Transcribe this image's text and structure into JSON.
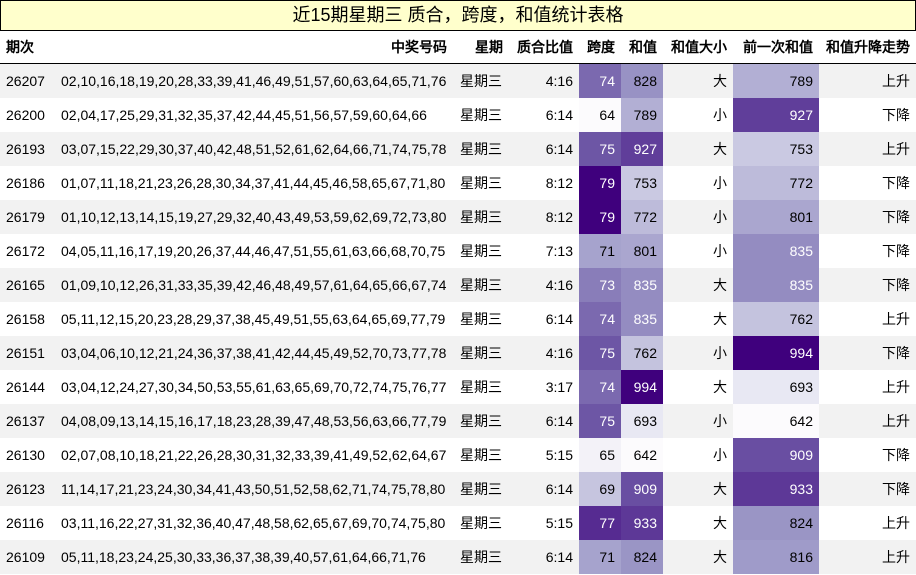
{
  "title": "近15期星期三 质合，跨度，和值统计表格",
  "headers": {
    "period": "期次",
    "numbers": "中奖号码",
    "weekday": "星期",
    "ratio": "质合比值",
    "span": "跨度",
    "sum": "和值",
    "size": "和值大小",
    "prev_sum": "前一次和值",
    "trend": "和值升降走势"
  },
  "heat_colors": {
    "low": "#fcfbfd",
    "high": "#3f007d"
  },
  "rows": [
    {
      "period": "26207",
      "numbers": "02,10,16,18,19,20,28,33,39,41,46,49,51,57,60,63,64,65,71,76",
      "weekday": "星期三",
      "ratio": "4:16",
      "span": "74",
      "sum": "828",
      "size": "大",
      "prev_sum": "789",
      "trend": "上升"
    },
    {
      "period": "26200",
      "numbers": "02,04,17,25,29,31,32,35,37,42,44,45,51,56,57,59,60,64,66",
      "weekday": "星期三",
      "ratio": "6:14",
      "span": "64",
      "sum": "789",
      "size": "小",
      "prev_sum": "927",
      "trend": "下降"
    },
    {
      "period": "26193",
      "numbers": "03,07,15,22,29,30,37,40,42,48,51,52,61,62,64,66,71,74,75,78",
      "weekday": "星期三",
      "ratio": "6:14",
      "span": "75",
      "sum": "927",
      "size": "大",
      "prev_sum": "753",
      "trend": "上升"
    },
    {
      "period": "26186",
      "numbers": "01,07,11,18,21,23,26,28,30,34,37,41,44,45,46,58,65,67,71,80",
      "weekday": "星期三",
      "ratio": "8:12",
      "span": "79",
      "sum": "753",
      "size": "小",
      "prev_sum": "772",
      "trend": "下降"
    },
    {
      "period": "26179",
      "numbers": "01,10,12,13,14,15,19,27,29,32,40,43,49,53,59,62,69,72,73,80",
      "weekday": "星期三",
      "ratio": "8:12",
      "span": "79",
      "sum": "772",
      "size": "小",
      "prev_sum": "801",
      "trend": "下降"
    },
    {
      "period": "26172",
      "numbers": "04,05,11,16,17,19,20,26,37,44,46,47,51,55,61,63,66,68,70,75",
      "weekday": "星期三",
      "ratio": "7:13",
      "span": "71",
      "sum": "801",
      "size": "小",
      "prev_sum": "835",
      "trend": "下降"
    },
    {
      "period": "26165",
      "numbers": "01,09,10,12,26,31,33,35,39,42,46,48,49,57,61,64,65,66,67,74",
      "weekday": "星期三",
      "ratio": "4:16",
      "span": "73",
      "sum": "835",
      "size": "大",
      "prev_sum": "835",
      "trend": "下降"
    },
    {
      "period": "26158",
      "numbers": "05,11,12,15,20,23,28,29,37,38,45,49,51,55,63,64,65,69,77,79",
      "weekday": "星期三",
      "ratio": "6:14",
      "span": "74",
      "sum": "835",
      "size": "大",
      "prev_sum": "762",
      "trend": "上升"
    },
    {
      "period": "26151",
      "numbers": "03,04,06,10,12,21,24,36,37,38,41,42,44,45,49,52,70,73,77,78",
      "weekday": "星期三",
      "ratio": "4:16",
      "span": "75",
      "sum": "762",
      "size": "小",
      "prev_sum": "994",
      "trend": "下降"
    },
    {
      "period": "26144",
      "numbers": "03,04,12,24,27,30,34,50,53,55,61,63,65,69,70,72,74,75,76,77",
      "weekday": "星期三",
      "ratio": "3:17",
      "span": "74",
      "sum": "994",
      "size": "大",
      "prev_sum": "693",
      "trend": "上升"
    },
    {
      "period": "26137",
      "numbers": "04,08,09,13,14,15,16,17,18,23,28,39,47,48,53,56,63,66,77,79",
      "weekday": "星期三",
      "ratio": "6:14",
      "span": "75",
      "sum": "693",
      "size": "小",
      "prev_sum": "642",
      "trend": "上升"
    },
    {
      "period": "26130",
      "numbers": "02,07,08,10,18,21,22,26,28,30,31,32,33,39,41,49,52,62,64,67",
      "weekday": "星期三",
      "ratio": "5:15",
      "span": "65",
      "sum": "642",
      "size": "小",
      "prev_sum": "909",
      "trend": "下降"
    },
    {
      "period": "26123",
      "numbers": "11,14,17,21,23,24,30,34,41,43,50,51,52,58,62,71,74,75,78,80",
      "weekday": "星期三",
      "ratio": "6:14",
      "span": "69",
      "sum": "909",
      "size": "大",
      "prev_sum": "933",
      "trend": "下降"
    },
    {
      "period": "26116",
      "numbers": "03,11,16,22,27,31,32,36,40,47,48,58,62,65,67,69,70,74,75,80",
      "weekday": "星期三",
      "ratio": "5:15",
      "span": "77",
      "sum": "933",
      "size": "大",
      "prev_sum": "824",
      "trend": "上升"
    },
    {
      "period": "26109",
      "numbers": "05,11,18,23,24,25,30,33,36,37,38,39,40,57,61,64,66,71,76",
      "weekday": "星期三",
      "ratio": "6:14",
      "span": "71",
      "sum": "824",
      "size": "大",
      "prev_sum": "816",
      "trend": "上升"
    }
  ]
}
